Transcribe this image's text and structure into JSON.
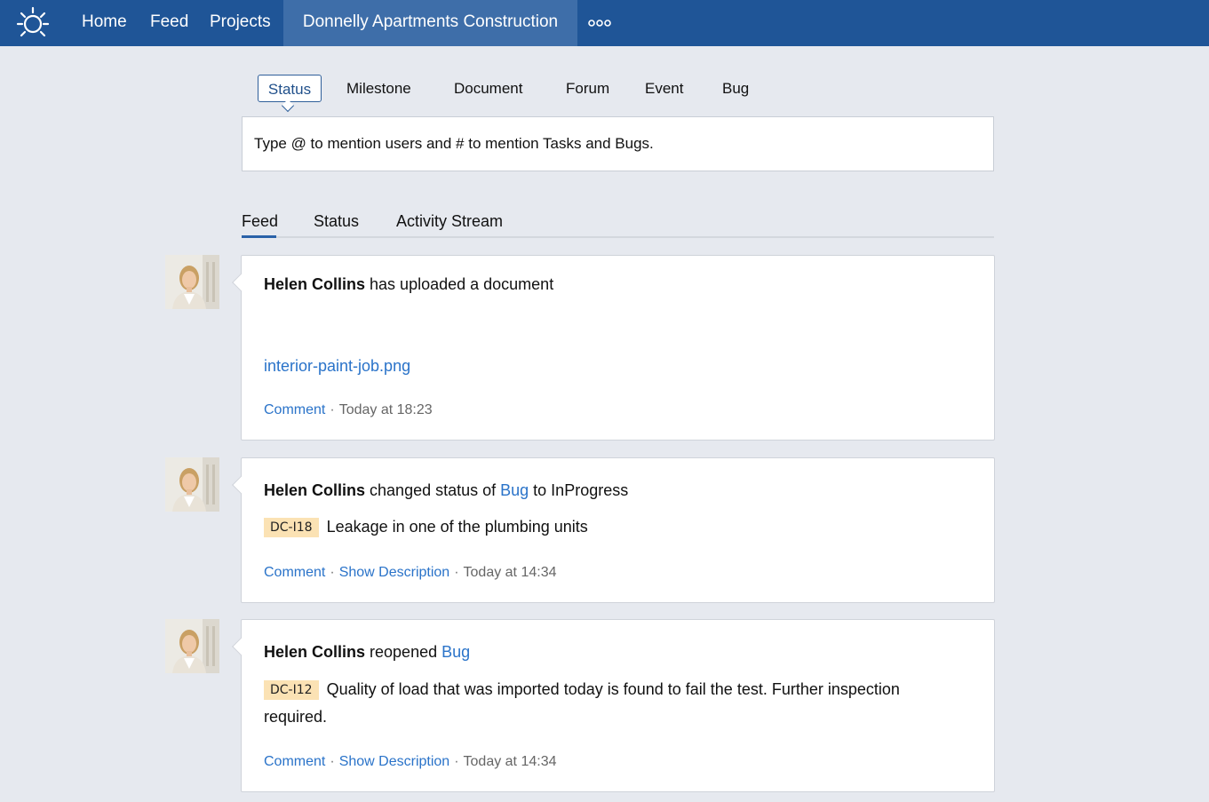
{
  "topbar": {
    "logo_icon": "bug-sun-icon",
    "nav": [
      "Home",
      "Feed",
      "Projects"
    ],
    "active_project": "Donnelly Apartments Construction",
    "more_icon": "more-dots-icon",
    "color": "#1f5597"
  },
  "composer": {
    "tabs": [
      "Status",
      "Milestone",
      "Document",
      "Forum",
      "Event",
      "Bug"
    ],
    "active_tab": "Status",
    "placeholder": "Type @ to mention users and # to mention Tasks and Bugs."
  },
  "feed_tabs": {
    "items": [
      "Feed",
      "Status",
      "Activity Stream"
    ],
    "active": "Feed"
  },
  "feed": [
    {
      "user": "Helen Collins",
      "action": " has uploaded a document",
      "document": "interior-paint-job.png",
      "comment_label": "Comment",
      "time": "Today at 18:23"
    },
    {
      "user": "Helen Collins",
      "action": " changed status of ",
      "link": "Bug",
      "action_suffix": " to InProgress",
      "bug_id": "DC-I18",
      "bug_title": "Leakage in one of the plumbing units",
      "comment_label": "Comment",
      "show_description_label": "Show Description",
      "time": "Today at 14:34"
    },
    {
      "user": "Helen Collins",
      "action": " reopened ",
      "link": "Bug",
      "bug_id": "DC-I12",
      "bug_title": "Quality of load that was imported today is found to fail the test. Further inspection required.",
      "comment_label": "Comment",
      "show_description_label": "Show Description",
      "time": "Today at 14:34"
    }
  ]
}
